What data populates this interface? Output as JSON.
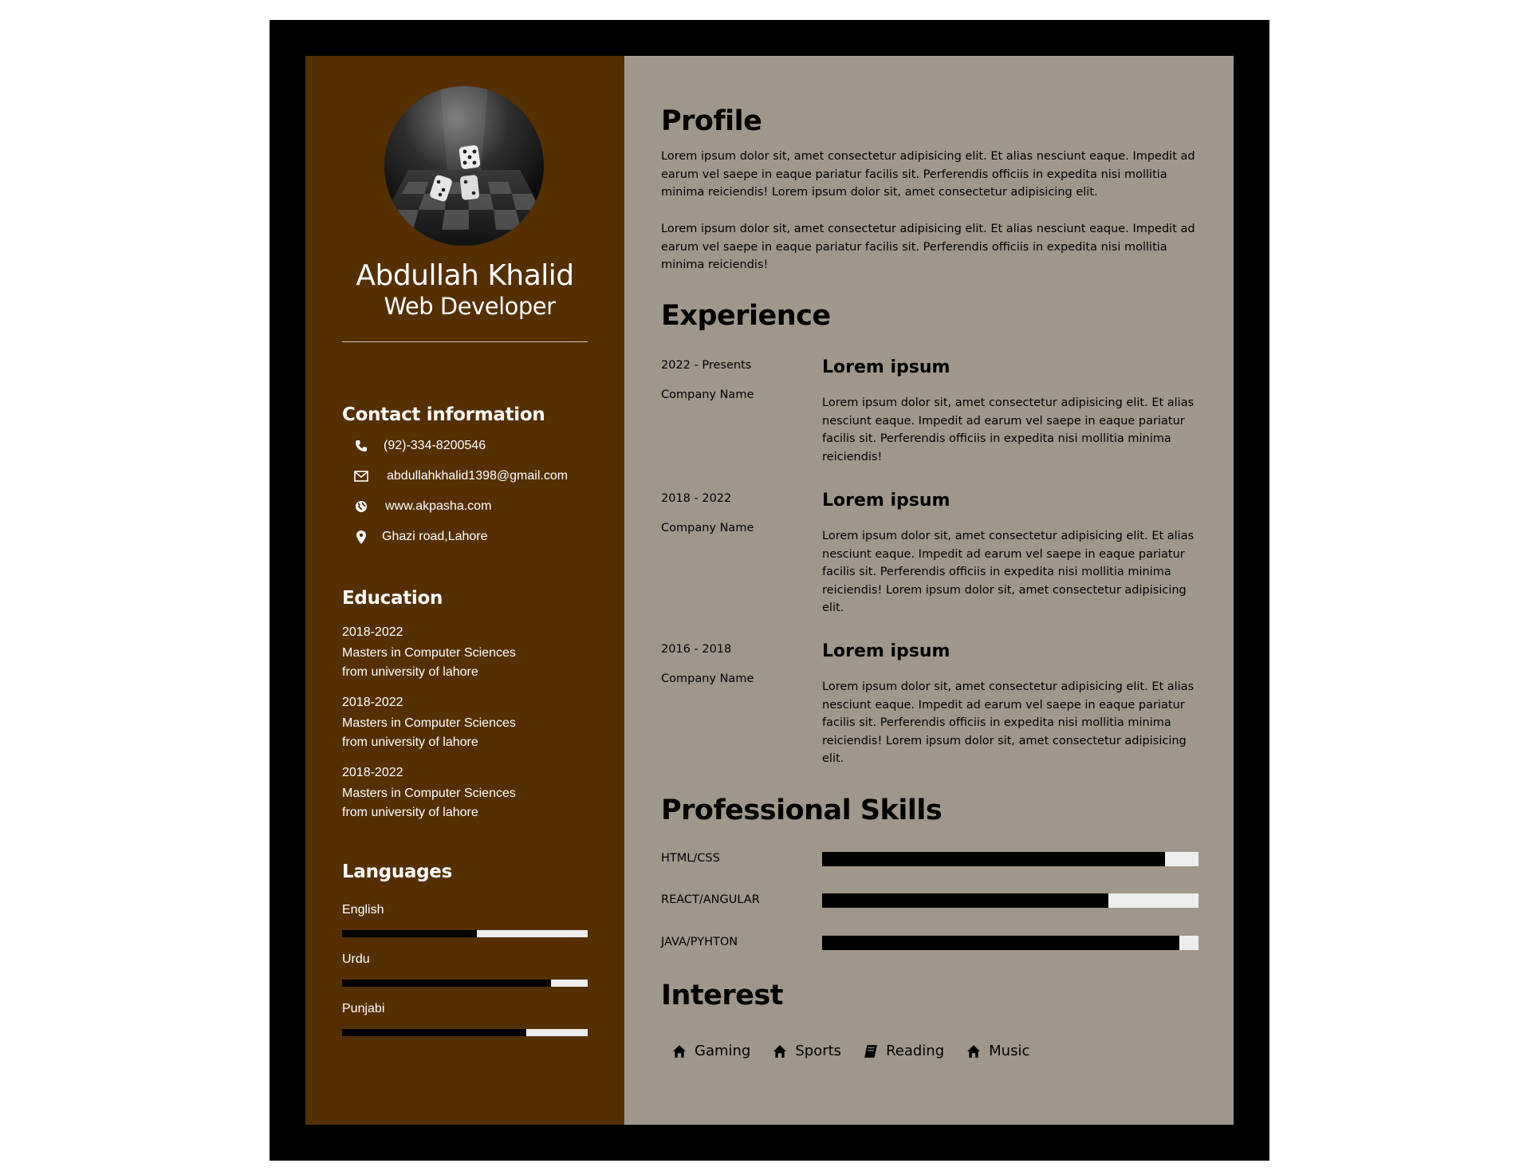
{
  "person": {
    "name": "Abdullah Khalid",
    "title": "Web Developer"
  },
  "contact": {
    "heading": "Contact information",
    "items": [
      {
        "icon": "phone-icon",
        "text": "(92)-334-8200546"
      },
      {
        "icon": "envelope-icon",
        "text": "abdullahkhalid1398@gmail.com"
      },
      {
        "icon": "globe-icon",
        "text": "www.akpasha.com"
      },
      {
        "icon": "map-pin-icon",
        "text": "Ghazi road,Lahore"
      }
    ]
  },
  "education": {
    "heading": "Education",
    "items": [
      {
        "years": "2018-2022",
        "degree": "Masters in Computer Sciences",
        "school": "from university of lahore"
      },
      {
        "years": "2018-2022",
        "degree": "Masters in Computer Sciences",
        "school": "from university of lahore"
      },
      {
        "years": "2018-2022",
        "degree": "Masters in Computer Sciences",
        "school": "from university of lahore"
      }
    ]
  },
  "languages": {
    "heading": "Languages",
    "items": [
      {
        "name": "English",
        "level": 0.55
      },
      {
        "name": "Urdu",
        "level": 0.85
      },
      {
        "name": "Punjabi",
        "level": 0.75
      }
    ]
  },
  "profile": {
    "heading": "Profile",
    "paragraphs": [
      "Lorem ipsum dolor sit, amet consectetur adipisicing elit. Et alias nesciunt eaque. Impedit ad earum vel saepe in eaque pariatur facilis sit. Perferendis officiis in expedita nisi mollitia minima reiciendis! Lorem ipsum dolor sit, amet consectetur adipisicing elit.",
      "Lorem ipsum dolor sit, amet consectetur adipisicing elit. Et alias nesciunt eaque. Impedit ad earum vel saepe in eaque pariatur facilis sit. Perferendis officiis in expedita nisi mollitia minima reiciendis!"
    ]
  },
  "experience": {
    "heading": "Experience",
    "items": [
      {
        "years": "2022 - Presents",
        "company": "Company Name",
        "title": "Lorem ipsum",
        "description": "Lorem ipsum dolor sit, amet consectetur adipisicing elit. Et alias nesciunt eaque. Impedit ad earum vel saepe in eaque pariatur facilis sit. Perferendis officiis in expedita nisi mollitia minima reiciendis!"
      },
      {
        "years": "2018 - 2022",
        "company": "Company Name",
        "title": "Lorem ipsum",
        "description": "Lorem ipsum dolor sit, amet consectetur adipisicing elit. Et alias nesciunt eaque. Impedit ad earum vel saepe in eaque pariatur facilis sit. Perferendis officiis in expedita nisi mollitia minima reiciendis! Lorem ipsum dolor sit, amet consectetur adipisicing elit."
      },
      {
        "years": "2016 - 2018",
        "company": "Company Name",
        "title": "Lorem ipsum",
        "description": "Lorem ipsum dolor sit, amet consectetur adipisicing elit. Et alias nesciunt eaque. Impedit ad earum vel saepe in eaque pariatur facilis sit. Perferendis officiis in expedita nisi mollitia minima reiciendis! Lorem ipsum dolor sit, amet consectetur adipisicing elit."
      }
    ]
  },
  "skills": {
    "heading": "Professional Skills",
    "items": [
      {
        "name": "HTML/CSS",
        "level": 0.91
      },
      {
        "name": "REACT/ANGULAR",
        "level": 0.76
      },
      {
        "name": "JAVA/PYHTON",
        "level": 0.95
      }
    ]
  },
  "interests": {
    "heading": "Interest",
    "items": [
      {
        "icon": "home-icon",
        "label": "Gaming"
      },
      {
        "icon": "home-icon",
        "label": "Sports"
      },
      {
        "icon": "book-icon",
        "label": "Reading"
      },
      {
        "icon": "home-icon",
        "label": "Music"
      }
    ]
  },
  "colors": {
    "sidebar": "#552f00",
    "main": "#a0978c",
    "frame": "#000000",
    "bar_track": "#ededed",
    "bar_fill": "#000000"
  }
}
